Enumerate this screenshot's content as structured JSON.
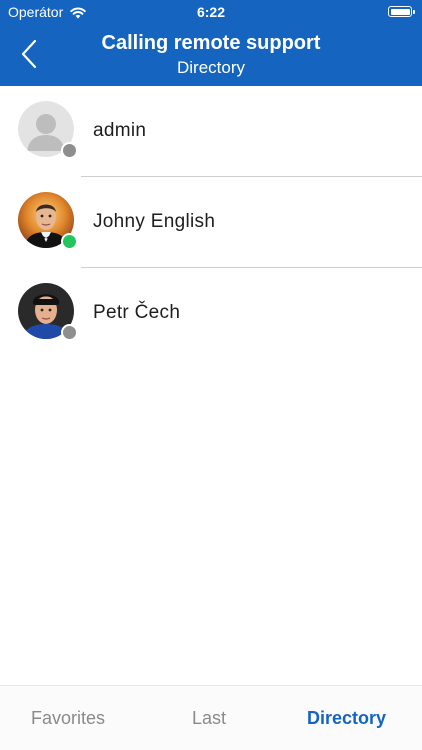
{
  "status_bar": {
    "carrier": "Operátor",
    "time": "6:22"
  },
  "nav": {
    "title": "Calling remote support",
    "subtitle": "Directory"
  },
  "contacts": [
    {
      "name": "admin",
      "status": "offline",
      "avatar": "placeholder-person-icon"
    },
    {
      "name": "Johny English",
      "status": "online",
      "avatar": "photo-man-in-tuxedo"
    },
    {
      "name": "Petr Čech",
      "status": "offline",
      "avatar": "photo-man-with-headgear"
    }
  ],
  "tabs": [
    {
      "label": "Favorites",
      "active": false
    },
    {
      "label": "Last",
      "active": false
    },
    {
      "label": "Directory",
      "active": true
    }
  ],
  "colors": {
    "brand": "#1565c0",
    "online": "#22c55e",
    "offline": "#8e8e8e"
  }
}
